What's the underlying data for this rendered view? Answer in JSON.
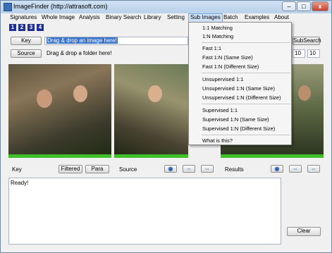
{
  "window": {
    "title": "ImageFinder (http://attrasoft.com)"
  },
  "controls": {
    "minimize": "–",
    "maximize": "□",
    "close": "x"
  },
  "menu": [
    "Signatures",
    "Whole Image",
    "Analysis",
    "Binary Search",
    "Library",
    "Setting",
    "Sub Images",
    "Batch",
    "Examples",
    "About"
  ],
  "page_tabs": [
    "1",
    "2",
    "3",
    "4"
  ],
  "key_row": {
    "button": "Key",
    "field_value": "Drag & drop an image here!",
    "subsearch": "SubSearch"
  },
  "source_row": {
    "button": "Source",
    "field_value": "Drag & drop a folder here!",
    "num1": "10",
    "num2": "10"
  },
  "bottom_row": {
    "key_label": "Key",
    "filtered": "Filtered",
    "para": "Para",
    "source_label": "Source",
    "results_label": "Results",
    "nav_glyphs": [
      "◉",
      "⇔",
      "⇔"
    ]
  },
  "status": {
    "text": "Ready!"
  },
  "clear_button": "Clear",
  "dropdown": {
    "group1": [
      "1:1 Matching",
      "1:N Matching"
    ],
    "group2": [
      "Fast 1:1",
      "Fast 1:N (Same Size)",
      "Fast 1:N (Different Size)"
    ],
    "group3": [
      "Unsupervised 1:1",
      "Unsupervised 1:N (Same Size)",
      "Unsupervised 1:N (Different Size)"
    ],
    "group4": [
      "Supervised 1:1",
      "Supervised 1:N (Same Size)",
      "Supervised 1:N (Different Size)"
    ],
    "group5": [
      "What is this?"
    ]
  },
  "colors": {
    "page_tab": "#1d2e94",
    "selection": "#3a73c9",
    "green_bar": "#3fbf2a",
    "menu_highlight": "#cfe3fb"
  }
}
